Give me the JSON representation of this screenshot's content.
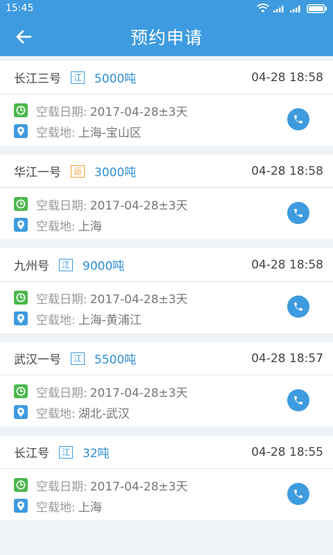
{
  "status_bar": {
    "time": "15:45"
  },
  "header": {
    "title": "预约申请"
  },
  "labels": {
    "empty_date": "空载日期:",
    "empty_place": "空载地:"
  },
  "colors": {
    "primary": "#3e9bdf",
    "green": "#4cb84c",
    "orange": "#f0a040"
  },
  "items": [
    {
      "ship": "长江三号",
      "badge": "江",
      "badge_color": "blue",
      "tonnage": "5000吨",
      "time": "04-28 18:58",
      "date": "2017-04-28±3天",
      "place": "上海-宝山区"
    },
    {
      "ship": "华江一号",
      "badge": "运",
      "badge_color": "orange",
      "tonnage": "3000吨",
      "time": "04-28 18:58",
      "date": "2017-04-28±3天",
      "place": "上海"
    },
    {
      "ship": "九州号",
      "badge": "江",
      "badge_color": "blue",
      "tonnage": "9000吨",
      "time": "04-28 18:58",
      "date": "2017-04-28±3天",
      "place": "上海-黄浦江"
    },
    {
      "ship": "武汉一号",
      "badge": "江",
      "badge_color": "blue",
      "tonnage": "5500吨",
      "time": "04-28 18:57",
      "date": "2017-04-28±3天",
      "place": "湖北-武汉"
    },
    {
      "ship": "长江号",
      "badge": "江",
      "badge_color": "blue",
      "tonnage": "32吨",
      "time": "04-28 18:55",
      "date": "2017-04-28±3天",
      "place": "上海"
    }
  ]
}
